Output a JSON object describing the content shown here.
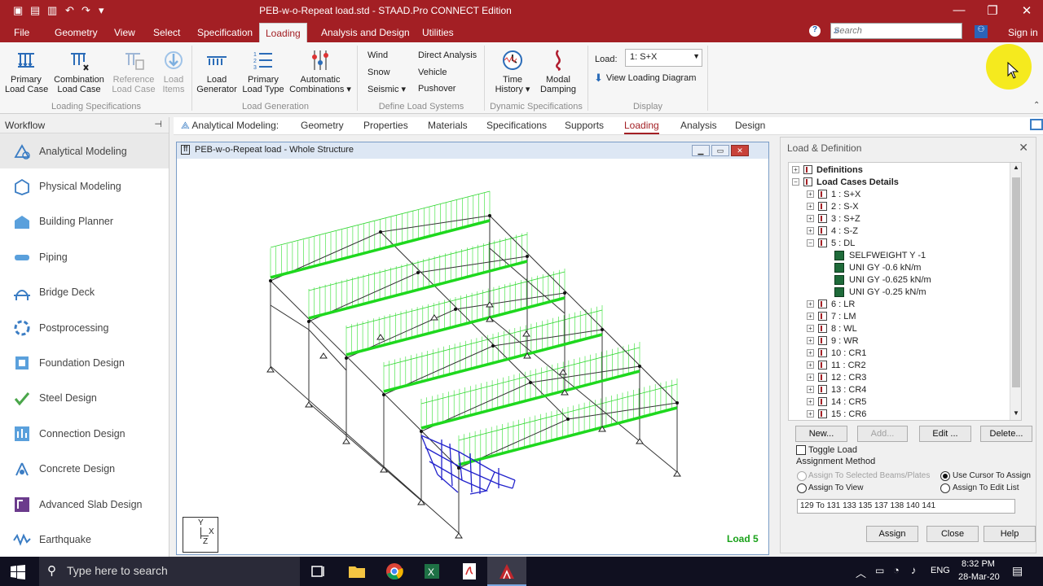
{
  "window": {
    "title": "PEB-w-o-Repeat load.std - STAAD.Pro CONNECT Edition"
  },
  "menu": {
    "file": "File",
    "items": [
      "Geometry",
      "View",
      "Select",
      "Specification",
      "Loading",
      "Analysis and Design",
      "Utilities"
    ],
    "signin": "Sign in"
  },
  "search": {
    "placeholder": "Search"
  },
  "ribbon": {
    "primary_load_case": "Primary\nLoad Case",
    "combination_load_case": "Combination\nLoad Case",
    "reference_load_case": "Reference\nLoad Case",
    "load_items": "Load\nItems",
    "load_generator": "Load\nGenerator",
    "primary_load_type": "Primary\nLoad Type",
    "automatic_combinations": "Automatic\nCombinations ▾",
    "wind": "Wind",
    "snow": "Snow",
    "seismic": "Seismic ▾",
    "direct_analysis": "Direct Analysis",
    "vehicle": "Vehicle",
    "pushover": "Pushover",
    "time_history": "Time\nHistory ▾",
    "modal_damping": "Modal\nDamping",
    "load_label": "Load:",
    "load_value": "1: S+X",
    "view_loading_diagram": "View Loading Diagram",
    "groups": [
      "Loading Specifications",
      "Load Generation",
      "Define Load Systems",
      "Dynamic Specifications",
      "Display"
    ]
  },
  "workflow": {
    "title": "Workflow",
    "items": [
      "Analytical Modeling",
      "Physical Modeling",
      "Building Planner",
      "Piping",
      "Bridge Deck",
      "Postprocessing",
      "Foundation Design",
      "Steel Design",
      "Connection Design",
      "Concrete Design",
      "Advanced Slab Design",
      "Earthquake"
    ]
  },
  "tabs": {
    "prefix": "Analytical Modeling:",
    "items": [
      "Geometry",
      "Properties",
      "Materials",
      "Specifications",
      "Supports",
      "Loading",
      "Analysis",
      "Design"
    ]
  },
  "viewport": {
    "title": "PEB-w-o-Repeat load - Whole Structure",
    "load_label": "Load 5",
    "axis_y": "Y",
    "axis_x": "X",
    "axis_z": "Z"
  },
  "load_definition": {
    "title": "Load & Definition",
    "definitions": "Definitions",
    "load_cases_details": "Load Cases Details",
    "cases": [
      "1 : S+X",
      "2 : S-X",
      "3 : S+Z",
      "4 : S-Z",
      "5 : DL",
      "6 : LR",
      "7 : LM",
      "8 : WL",
      "9 : WR",
      "10 : CR1",
      "11 : CR2",
      "12 : CR3",
      "13 : CR4",
      "14 : CR5",
      "15 : CR6"
    ],
    "dl_items": [
      "SELFWEIGHT Y -1",
      "UNI GY -0.6 kN/m",
      "UNI GY -0.625 kN/m",
      "UNI GY -0.25 kN/m"
    ],
    "buttons": {
      "new": "New...",
      "add": "Add...",
      "edit": "Edit ...",
      "delete": "Delete..."
    },
    "toggle_load": "Toggle Load",
    "assignment_method": "Assignment Method",
    "assign_selected": "Assign To Selected Beams/Plates",
    "use_cursor": "Use Cursor To Assign",
    "assign_view": "Assign To View",
    "assign_edit_list": "Assign To Edit List",
    "member_list": "129 To 131 133 135 137 138 140 141",
    "assign": "Assign",
    "close": "Close",
    "help": "Help"
  },
  "taskbar": {
    "search": "Type here to search",
    "lang": "ENG",
    "time": "8:32 PM",
    "date": "28-Mar-20"
  }
}
